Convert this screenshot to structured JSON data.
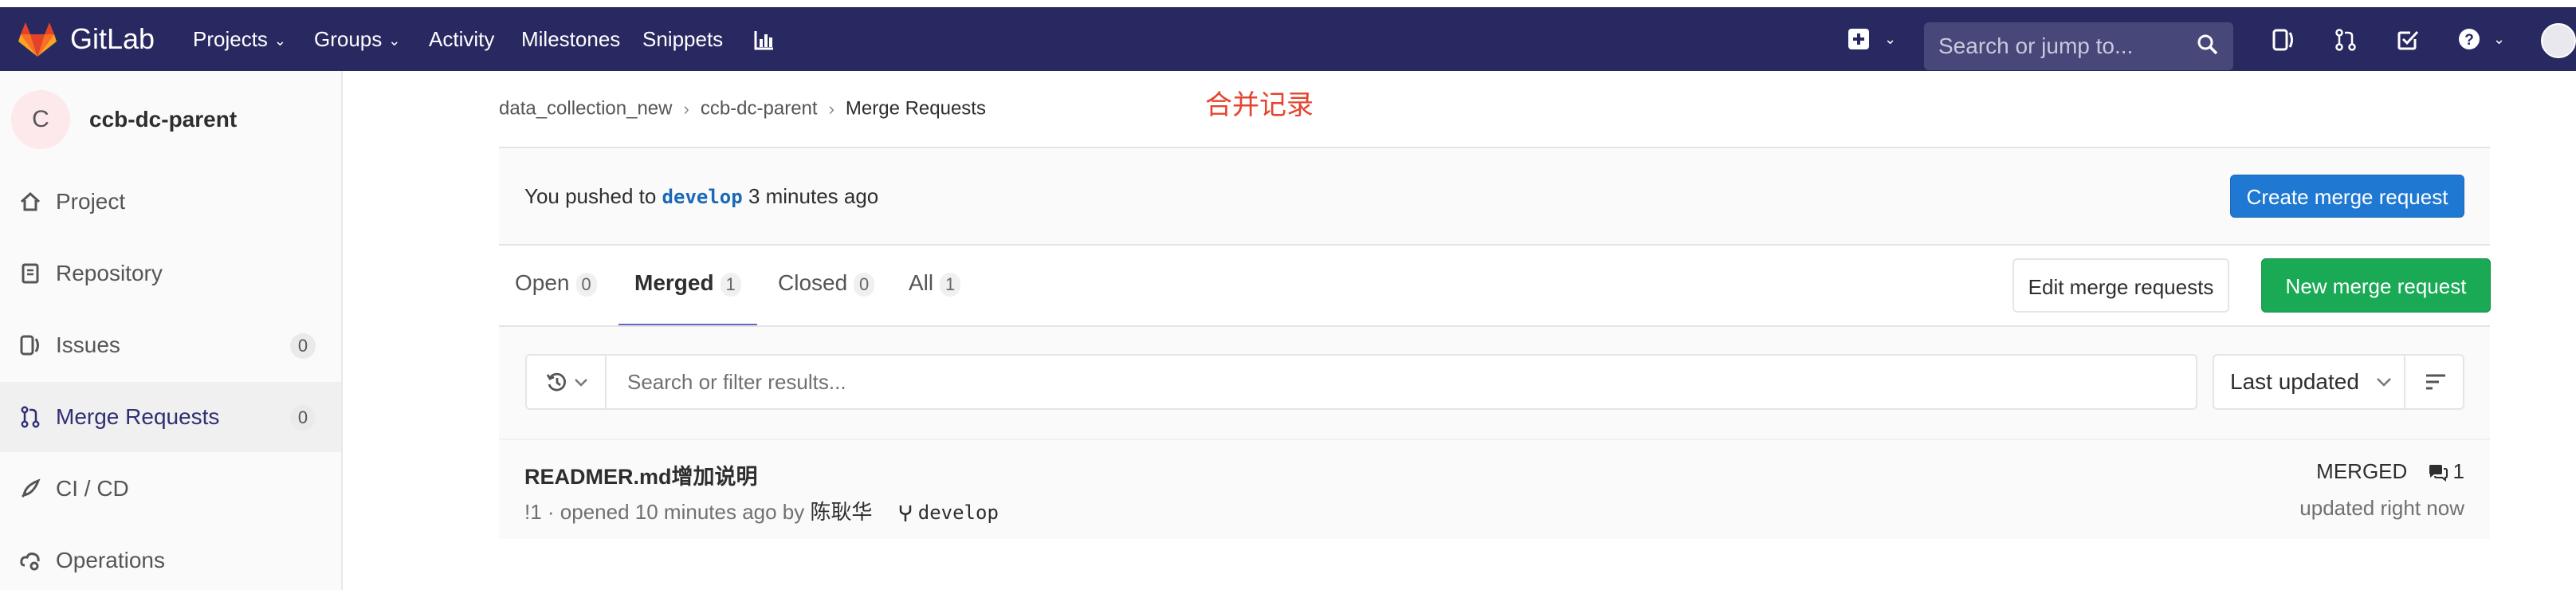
{
  "navbar": {
    "brand": "GitLab",
    "items": [
      {
        "label": "Projects",
        "caret": true
      },
      {
        "label": "Groups",
        "caret": true
      },
      {
        "label": "Activity",
        "caret": false
      },
      {
        "label": "Milestones",
        "caret": false
      },
      {
        "label": "Snippets",
        "caret": false
      }
    ],
    "icons": [
      "chart-icon",
      "plus-square-icon",
      "issues-icon",
      "merge-request-icon",
      "todo-check-icon",
      "help-icon",
      "user-avatar"
    ],
    "search_placeholder": "Search or jump to...",
    "bg_color": "#292961"
  },
  "sidebar": {
    "project_avatar_letter": "C",
    "project_name": "ccb-dc-parent",
    "items": [
      {
        "label": "Project",
        "icon": "home-icon",
        "active": false
      },
      {
        "label": "Repository",
        "icon": "book-icon",
        "active": false
      },
      {
        "label": "Issues",
        "icon": "issues-icon",
        "badge": "0",
        "active": false
      },
      {
        "label": "Merge Requests",
        "icon": "merge-request-icon",
        "badge": "0",
        "active": true
      },
      {
        "label": "CI / CD",
        "icon": "rocket-icon",
        "active": false
      },
      {
        "label": "Operations",
        "icon": "cloud-gear-icon",
        "active": false
      }
    ]
  },
  "breadcrumb": {
    "items": [
      "data_collection_new",
      "ccb-dc-parent",
      "Merge Requests"
    ]
  },
  "annotation": "合并记录",
  "push_notice": {
    "prefix": "You pushed to",
    "branch": "develop",
    "suffix": "3 minutes ago",
    "button": "Create merge request"
  },
  "tabs": [
    {
      "label": "Open",
      "count": "0",
      "active": false
    },
    {
      "label": "Merged",
      "count": "1",
      "active": true
    },
    {
      "label": "Closed",
      "count": "0",
      "active": false
    },
    {
      "label": "All",
      "count": "1",
      "active": false
    }
  ],
  "actions": {
    "edit": "Edit merge requests",
    "new": "New merge request"
  },
  "filter": {
    "placeholder": "Search or filter results...",
    "sort_label": "Last updated"
  },
  "merge_requests": [
    {
      "title": "READMER.md增加说明",
      "ref": "!1",
      "opened": "· opened 10 minutes ago by",
      "author": "陈耿华",
      "branch": "develop",
      "status": "MERGED",
      "comments": "1",
      "updated": "updated right now"
    }
  ],
  "colors": {
    "accent_blue": "#1f78d1",
    "success_green": "#1aaa55",
    "annotation_red": "#e5452f",
    "active_tab_underline": "#6666c4"
  }
}
